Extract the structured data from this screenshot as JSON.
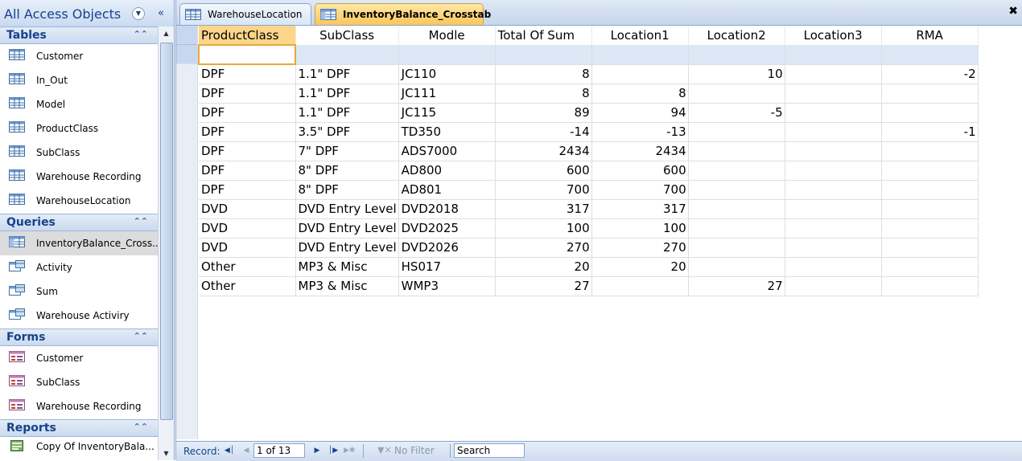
{
  "nav": {
    "title": "All Access Objects",
    "groups": [
      {
        "label": "Tables",
        "items": [
          {
            "label": "Customer"
          },
          {
            "label": "In_Out"
          },
          {
            "label": "Model"
          },
          {
            "label": "ProductClass"
          },
          {
            "label": "SubClass"
          },
          {
            "label": "Warehouse Recording"
          },
          {
            "label": "WarehouseLocation"
          }
        ]
      },
      {
        "label": "Queries",
        "items": [
          {
            "label": "InventoryBalance_Cross..."
          },
          {
            "label": "Activity"
          },
          {
            "label": "Sum"
          },
          {
            "label": "Warehouse Activiry"
          }
        ]
      },
      {
        "label": "Forms",
        "items": [
          {
            "label": "Customer"
          },
          {
            "label": "SubClass"
          },
          {
            "label": "Warehouse Recording"
          }
        ]
      },
      {
        "label": "Reports",
        "items": [
          {
            "label": "Copy Of InventoryBala..."
          }
        ]
      }
    ]
  },
  "tabs": [
    {
      "label": "WarehouseLocation"
    },
    {
      "label": "InventoryBalance_Crosstab"
    }
  ],
  "grid": {
    "columns": [
      "ProductClass",
      "SubClass",
      "Modle",
      "Total Of Sum",
      "Location1",
      "Location2",
      "Location3",
      "RMA"
    ],
    "rows": [
      [
        "DPF",
        "1.1\" DPF",
        "JC110",
        "8",
        "",
        "10",
        "",
        "-2"
      ],
      [
        "DPF",
        "1.1\" DPF",
        "JC111",
        "8",
        "8",
        "",
        "",
        ""
      ],
      [
        "DPF",
        "1.1\" DPF",
        "JC115",
        "89",
        "94",
        "-5",
        "",
        ""
      ],
      [
        "DPF",
        "3.5\" DPF",
        "TD350",
        "-14",
        "-13",
        "",
        "",
        "-1"
      ],
      [
        "DPF",
        "7\" DPF",
        "ADS7000",
        "2434",
        "2434",
        "",
        "",
        ""
      ],
      [
        "DPF",
        "8\" DPF",
        "AD800",
        "600",
        "600",
        "",
        "",
        ""
      ],
      [
        "DPF",
        "8\" DPF",
        "AD801",
        "700",
        "700",
        "",
        "",
        ""
      ],
      [
        "DVD",
        "DVD Entry Level",
        "DVD2018",
        "317",
        "317",
        "",
        "",
        ""
      ],
      [
        "DVD",
        "DVD Entry Level",
        "DVD2025",
        "100",
        "100",
        "",
        "",
        ""
      ],
      [
        "DVD",
        "DVD Entry Level",
        "DVD2026",
        "270",
        "270",
        "",
        "",
        ""
      ],
      [
        "Other",
        "MP3 & Misc",
        "HS017",
        "20",
        "20",
        "",
        "",
        ""
      ],
      [
        "Other",
        "MP3 & Misc",
        "WMP3",
        "27",
        "",
        "27",
        "",
        ""
      ]
    ]
  },
  "recnav": {
    "label": "Record:",
    "position": "1 of 13",
    "filter": "No Filter",
    "search": "Search"
  },
  "icons": {
    "table": "table-icon",
    "query": "query-icon",
    "form": "form-icon",
    "report": "report-icon",
    "close": "close-icon"
  }
}
